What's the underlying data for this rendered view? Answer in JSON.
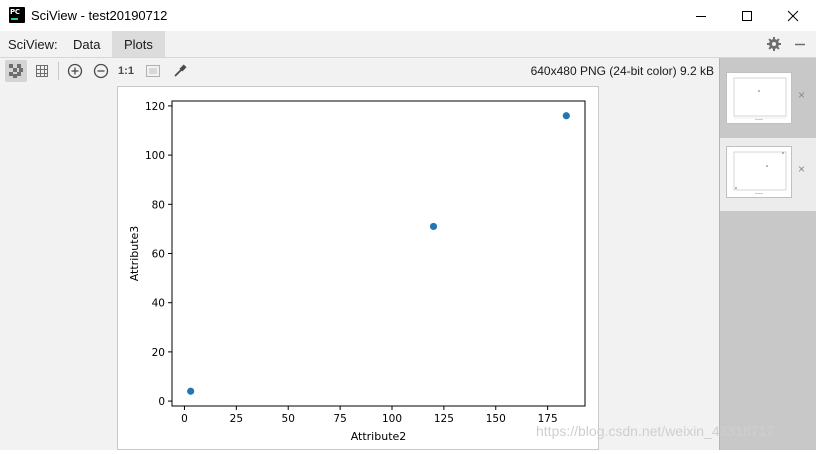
{
  "window": {
    "title": "SciView - test20190712",
    "logo_text": "PC"
  },
  "tabbar": {
    "prefix_label": "SciView:",
    "tabs": [
      {
        "label": "Data",
        "active": false
      },
      {
        "label": "Plots",
        "active": true
      }
    ]
  },
  "toolbar": {
    "tools": [
      {
        "icon": "checkerboard-icon",
        "selected": true
      },
      {
        "icon": "grid-icon",
        "selected": false
      },
      {
        "icon": "zoom-in-icon",
        "selected": false
      },
      {
        "icon": "zoom-out-icon",
        "selected": false
      },
      {
        "icon": "actual-size-icon",
        "label": "1:1",
        "selected": false
      },
      {
        "icon": "fit-icon",
        "selected": false
      },
      {
        "icon": "color-picker-icon",
        "selected": false
      }
    ],
    "image_info": "640x480 PNG (24-bit color) 9.2 kB"
  },
  "plots_panel": {
    "thumbnails": [
      {
        "selected": false,
        "close": "×"
      },
      {
        "selected": true,
        "close": "×"
      }
    ]
  },
  "chart_data": {
    "type": "scatter",
    "x": [
      3,
      120,
      184
    ],
    "y": [
      4,
      71,
      116
    ],
    "xlabel": "Attribute2",
    "ylabel": "Attribute3",
    "xticks": [
      0,
      25,
      50,
      75,
      100,
      125,
      150,
      175
    ],
    "yticks": [
      0,
      20,
      40,
      60,
      80,
      100,
      120
    ],
    "xlim": [
      -6,
      193
    ],
    "ylim": [
      -2,
      122
    ],
    "color": "#1f77b4",
    "grid": false
  },
  "watermark": "https://blog.csdn.net/weixin_43318717"
}
